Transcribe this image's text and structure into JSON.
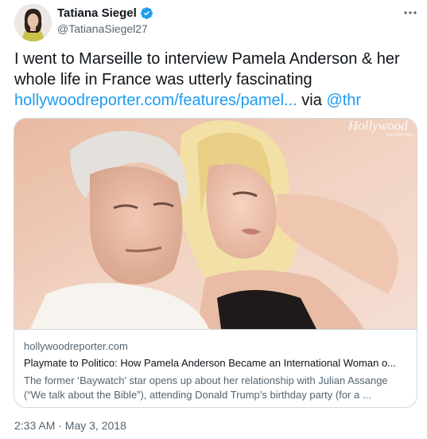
{
  "author": {
    "name": "Tatiana Siegel",
    "handle": "@TatianaSiegel27"
  },
  "tweet": {
    "text_line1": "I went to Marseille to interview Pamela Anderson & her",
    "text_line2": "whole life in France was utterly fascinating",
    "link": "hollywoodreporter.com/features/pamel...",
    "via": "via",
    "mention": "@thr"
  },
  "card": {
    "watermark": "Hollywood",
    "watermark_sub": "REPORTER",
    "domain": "hollywoodreporter.com",
    "title": "Playmate to Politico: How Pamela Anderson Became an International Woman o...",
    "desc_line1": "The former ‘Baywatch’ star opens up about her relationship with Julian Assange",
    "desc_line2": "(“We talk about the Bible”), attending Donald Trump’s birthday party (for a ..."
  },
  "meta": {
    "timestamp": "2:33 AM · May 3, 2018"
  },
  "icons": {
    "verified": "verified-badge-icon",
    "more": "more-options-icon"
  },
  "colors": {
    "link": "#1d9bf0",
    "text": "#0f1419",
    "secondary": "#536471",
    "border": "#cfd9de"
  }
}
